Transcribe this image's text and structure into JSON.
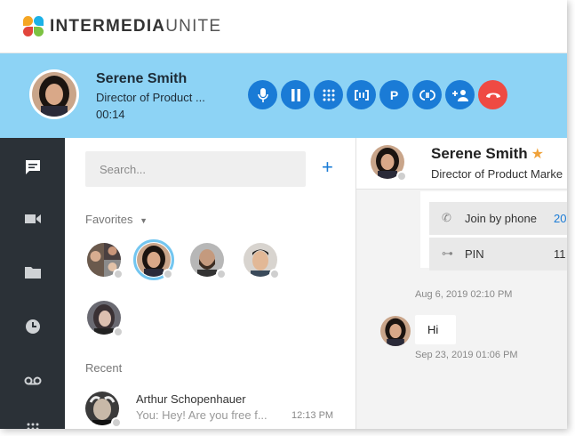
{
  "brand": {
    "name_bold": "INTERMEDIA",
    "name_light": "UNITE"
  },
  "call": {
    "name": "Serene Smith",
    "title": "Director of Product ...",
    "timer": "00:14",
    "buttons": [
      {
        "id": "mute",
        "icon": "microphone-icon"
      },
      {
        "id": "hold",
        "icon": "pause-icon"
      },
      {
        "id": "keypad",
        "icon": "dialpad-icon"
      },
      {
        "id": "transfer",
        "icon": "transfer-icon"
      },
      {
        "id": "park",
        "label": "P"
      },
      {
        "id": "merge",
        "icon": "merge-icon"
      },
      {
        "id": "add-participant",
        "icon": "add-person-icon"
      },
      {
        "id": "hangup",
        "icon": "hangup-icon"
      }
    ],
    "colors": {
      "bar": "#8dd3f5",
      "button": "#1a7bd6",
      "hangup": "#ef4a43"
    }
  },
  "rail": {
    "items": [
      "chat-icon",
      "video-icon",
      "folder-icon",
      "clock-icon",
      "voicemail-icon",
      "dialpad-icon"
    ],
    "color": "#2b3137"
  },
  "contacts": {
    "search_placeholder": "Search...",
    "add_label": "+",
    "favorites_label": "Favorites",
    "recent_label": "Recent",
    "recent": [
      {
        "name": "Arthur Schopenhauer",
        "preview": "You: Hey! Are you free f...",
        "time": "12:13 PM"
      }
    ]
  },
  "chat": {
    "name": "Serene Smith",
    "title": "Director of Product Marke",
    "join": [
      {
        "label": "Join by phone",
        "value": "20"
      },
      {
        "label": "PIN",
        "value": "11"
      }
    ],
    "timestamp1": "Aug 6, 2019 02:10 PM",
    "message": "Hi",
    "timestamp2": "Sep 23, 2019 01:06 PM"
  }
}
